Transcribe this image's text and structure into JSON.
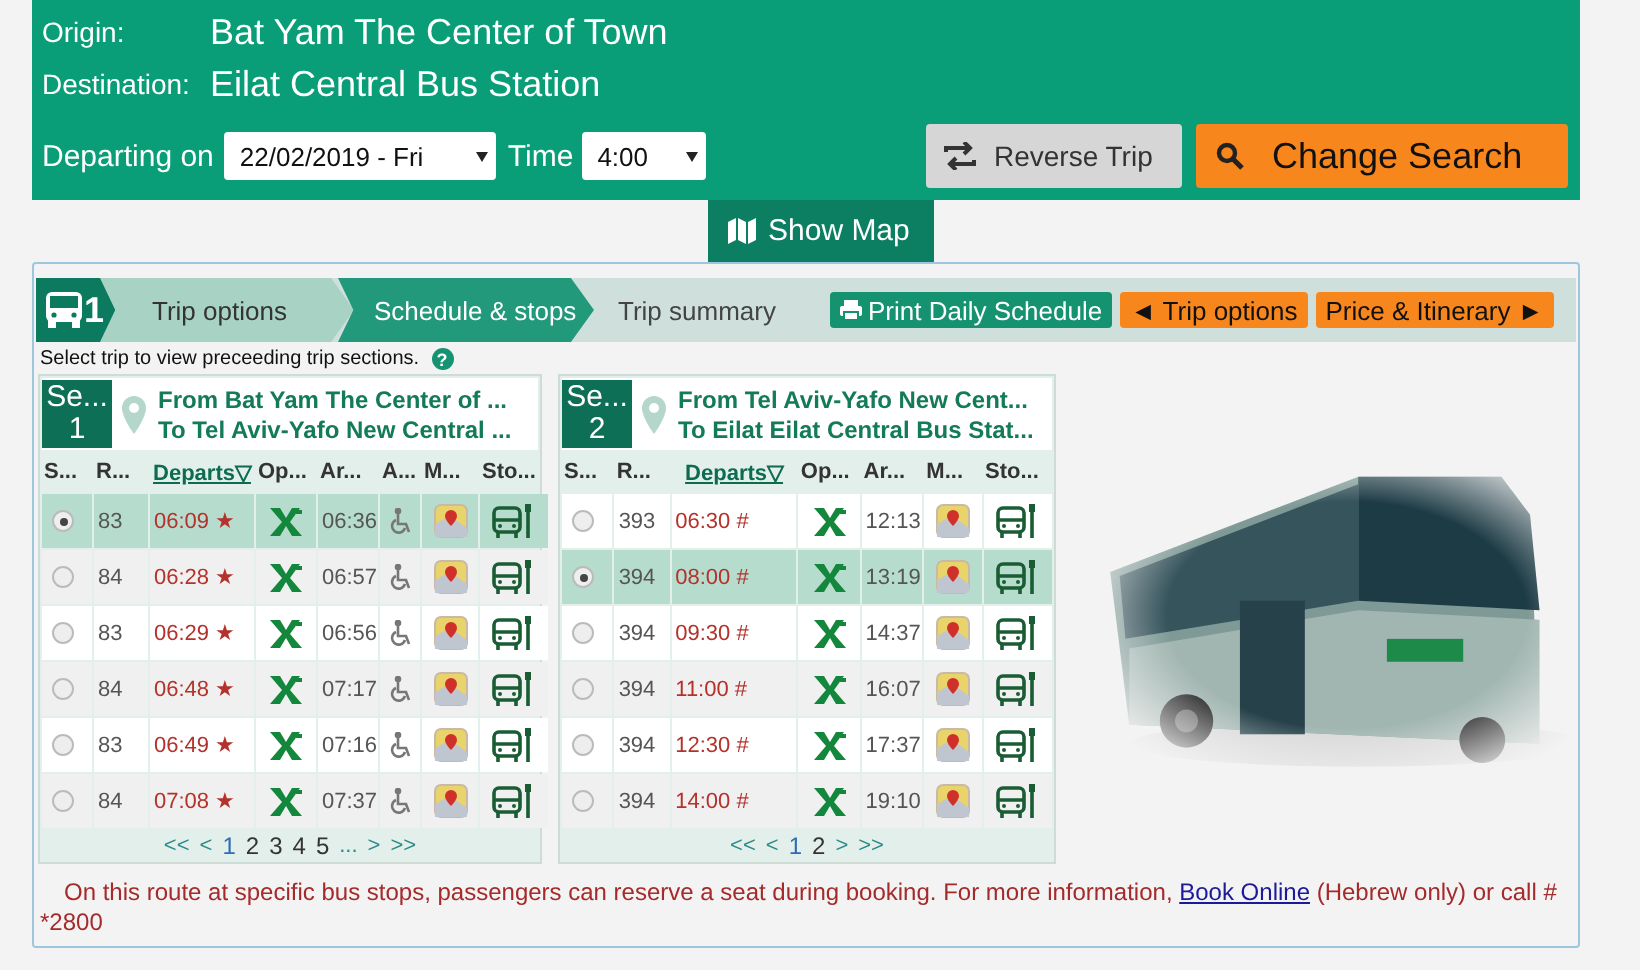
{
  "search": {
    "origin_label": "Origin:",
    "origin": "Bat Yam The Center of Town",
    "destination_label": "Destination:",
    "destination": "Eilat Central Bus Station",
    "departing_label": "Departing on",
    "date": "22/02/2019 - Fri",
    "time_label": "Time",
    "time": "4:00",
    "reverse_button": "Reverse Trip",
    "change_button": "Change Search"
  },
  "show_map": "Show Map",
  "steps": {
    "icon_number": "1",
    "items": [
      {
        "label": "Trip options",
        "selected": false
      },
      {
        "label": "Schedule & stops",
        "selected": true
      },
      {
        "label": "Trip summary",
        "selected": false
      }
    ]
  },
  "actions": [
    {
      "label": "Print Daily Schedule",
      "kind": "print"
    },
    {
      "label": "◄ Trip options",
      "kind": "nav"
    },
    {
      "label": "Price & Itinerary ►",
      "kind": "nav"
    }
  ],
  "hint": {
    "text": "Select trip to view preceeding trip sections.",
    "help": "?"
  },
  "sections": [
    {
      "label": "Se...",
      "number": "1",
      "from": "From Bat Yam The Center of ...",
      "to": "To Tel Aviv-Yafo New Central ...",
      "mark": "★",
      "columns": [
        {
          "label": "S...",
          "kind": "select",
          "sorted": false
        },
        {
          "label": "R...",
          "kind": "route",
          "sorted": false
        },
        {
          "label": "Departs▽",
          "kind": "departs",
          "sorted": true
        },
        {
          "label": "Op...",
          "kind": "operator",
          "sorted": false
        },
        {
          "label": "Ar...",
          "kind": "arrives",
          "sorted": false
        },
        {
          "label": "A...",
          "kind": "accessible",
          "sorted": false
        },
        {
          "label": "M...",
          "kind": "map",
          "sorted": false
        },
        {
          "label": "Sto...",
          "kind": "stops",
          "sorted": false
        }
      ],
      "rows": [
        {
          "selected": true,
          "route": "83",
          "departs": "06:09",
          "arrives": "06:36"
        },
        {
          "selected": false,
          "route": "84",
          "departs": "06:28",
          "arrives": "06:57"
        },
        {
          "selected": false,
          "route": "83",
          "departs": "06:29",
          "arrives": "06:56"
        },
        {
          "selected": false,
          "route": "84",
          "departs": "06:48",
          "arrives": "07:17"
        },
        {
          "selected": false,
          "route": "83",
          "departs": "06:49",
          "arrives": "07:16"
        },
        {
          "selected": false,
          "route": "84",
          "departs": "07:08",
          "arrives": "07:37"
        }
      ],
      "pagination": [
        {
          "label": "<<",
          "selected": false
        },
        {
          "label": "<",
          "selected": false
        },
        {
          "label": "1",
          "selected": true
        },
        {
          "label": "2",
          "selected": false
        },
        {
          "label": "3",
          "selected": false
        },
        {
          "label": "4",
          "selected": false
        },
        {
          "label": "5",
          "selected": false
        },
        {
          "label": "...",
          "selected": false
        },
        {
          "label": ">",
          "selected": false
        },
        {
          "label": ">>",
          "selected": false
        }
      ]
    },
    {
      "label": "Se...",
      "number": "2",
      "from": "From Tel Aviv-Yafo New Cent...",
      "to": "To Eilat Eilat Central Bus Stat...",
      "mark": "#",
      "columns": [
        {
          "label": "S...",
          "kind": "select",
          "sorted": false
        },
        {
          "label": "R...",
          "kind": "route",
          "sorted": false
        },
        {
          "label": "Departs▽",
          "kind": "departs",
          "sorted": true
        },
        {
          "label": "Op...",
          "kind": "operator",
          "sorted": false
        },
        {
          "label": "Ar...",
          "kind": "arrives",
          "sorted": false
        },
        {
          "label": "M...",
          "kind": "map",
          "sorted": false
        },
        {
          "label": "Sto...",
          "kind": "stops",
          "sorted": false
        }
      ],
      "rows": [
        {
          "selected": false,
          "route": "393",
          "departs": "06:30",
          "arrives": "12:13"
        },
        {
          "selected": true,
          "route": "394",
          "departs": "08:00",
          "arrives": "13:19"
        },
        {
          "selected": false,
          "route": "394",
          "departs": "09:30",
          "arrives": "14:37"
        },
        {
          "selected": false,
          "route": "394",
          "departs": "11:00",
          "arrives": "16:07"
        },
        {
          "selected": false,
          "route": "394",
          "departs": "12:30",
          "arrives": "17:37"
        },
        {
          "selected": false,
          "route": "394",
          "departs": "14:00",
          "arrives": "19:10"
        }
      ],
      "pagination": [
        {
          "label": "<<",
          "selected": false
        },
        {
          "label": "<",
          "selected": false
        },
        {
          "label": "1",
          "selected": true
        },
        {
          "label": "2",
          "selected": false
        },
        {
          "label": ">",
          "selected": false
        },
        {
          "label": ">>",
          "selected": false
        }
      ]
    }
  ],
  "note": {
    "before": "On this route at specific bus stops, passengers can reserve a seat during booking. For more information, ",
    "link": "Book Online",
    "after": " (Hebrew only) or call # *2800"
  }
}
